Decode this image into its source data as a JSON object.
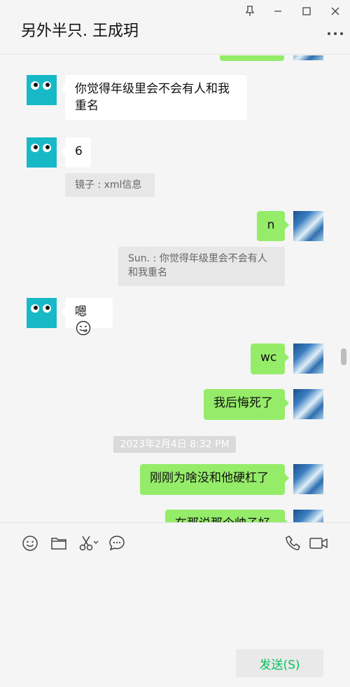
{
  "header": {
    "title": "另外半只. 王成玥"
  },
  "messages": [
    {
      "side": "right",
      "text": ""
    },
    {
      "side": "left",
      "text_line1": "你觉得年级里会不会有人和我",
      "text_line2": "重名"
    },
    {
      "side": "left",
      "text": "6"
    },
    {
      "quote": "镜子 : xml信息"
    },
    {
      "side": "right",
      "text": "n"
    },
    {
      "quote_line1": "Sun. : 你觉得年级里会不会有人",
      "quote_line2": "和我重名"
    },
    {
      "side": "left",
      "text": "嗯"
    },
    {
      "side": "right",
      "text": "wc"
    },
    {
      "side": "right",
      "text": "我后悔死了"
    },
    {
      "timestamp": "2023年2月4日 8:32 PM"
    },
    {
      "side": "right",
      "text": "刚刚为啥没和他硬杠了"
    },
    {
      "side": "right",
      "text": "在那说那个帅子好"
    }
  ],
  "toolbar": {
    "emoji_icon": "emoji-icon",
    "folder_icon": "folder-icon",
    "scissors_icon": "scissors-icon",
    "chat_icon": "chat-bubble-icon",
    "phone_icon": "phone-icon",
    "video_icon": "video-camera-icon"
  },
  "send_label": "发送(S)",
  "colors": {
    "bubble_self": "#95ec69",
    "bubble_other": "#ffffff",
    "send_text": "#07c160"
  }
}
